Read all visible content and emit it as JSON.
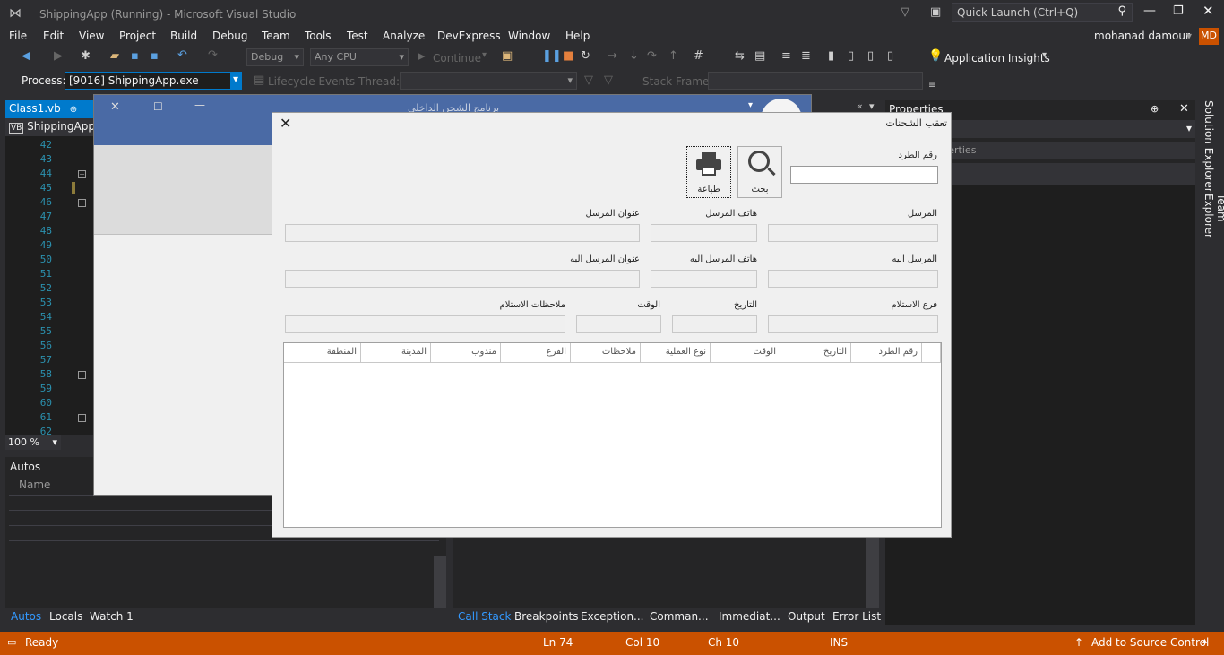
{
  "window_title": "ShippingApp (Running) - Microsoft Visual Studio",
  "quick_launch_placeholder": "Quick Launch (Ctrl+Q)",
  "user_name": "mohanad damour",
  "user_initials": "MD",
  "menu": [
    "File",
    "Edit",
    "View",
    "Project",
    "Build",
    "Debug",
    "Team",
    "Tools",
    "Test",
    "Analyze",
    "DevExpress",
    "Window",
    "Help"
  ],
  "toolbar": {
    "config": "Debug",
    "platform": "Any CPU",
    "continue_label": "Continue",
    "app_insights": "Application Insights"
  },
  "procbar": {
    "process_label": "Process:",
    "process_value": "[9016] ShippingApp.exe",
    "lifecycle": "Lifecycle Events",
    "thread_label": "Thread:",
    "stack_frame_label": "Stack Frame:"
  },
  "editor": {
    "tab_name": "Class1.vb",
    "project_name": "ShippingApp",
    "line_numbers": [
      "42",
      "43",
      "44",
      "45",
      "46",
      "47",
      "48",
      "49",
      "50",
      "51",
      "52",
      "53",
      "54",
      "55",
      "56",
      "57",
      "58",
      "59",
      "60",
      "61",
      "62"
    ],
    "zoom": "100 %"
  },
  "autos": {
    "title": "Autos",
    "name_col": "Name",
    "tabs": [
      "Autos",
      "Locals",
      "Watch 1"
    ]
  },
  "bottom_tabs": [
    "Call Stack",
    "Breakpoints",
    "Exception...",
    "Comman...",
    "Immediat...",
    "Output",
    "Error List"
  ],
  "properties": {
    "title": "Properties",
    "search_placeholder": "Search properties"
  },
  "side_tabs": [
    "Solution Explorer",
    "Team Explorer"
  ],
  "bg_form_title": "برنامج الشحن الداخلي",
  "dialog": {
    "title": "تعقب الشحنات",
    "parcel_no_label": "رقم الطرد",
    "search_button": "بحث",
    "print_button": "طباعة",
    "sender_label": "المرسل",
    "sender_phone_label": "هاتف المرسل",
    "sender_address_label": "عنوان المرسل",
    "receiver_label": "المرسل اليه",
    "receiver_phone_label": "هاتف المرسل اليه",
    "receiver_address_label": "عنوان المرسل اليه",
    "receive_branch_label": "فرع الاستلام",
    "date_label": "التاريخ",
    "time_label": "الوقت",
    "receive_notes_label": "ملاحظات الاستلام",
    "grid_columns": [
      "رقم الطرد",
      "التاريخ",
      "الوقت",
      "نوع العملية",
      "ملاحظات",
      "الفرع",
      "مندوب",
      "المدينة",
      "المنطقة"
    ]
  },
  "status": {
    "ready": "Ready",
    "ln": "Ln 74",
    "col": "Col 10",
    "ch": "Ch 10",
    "ins": "INS",
    "source_control": "Add to Source Control"
  }
}
